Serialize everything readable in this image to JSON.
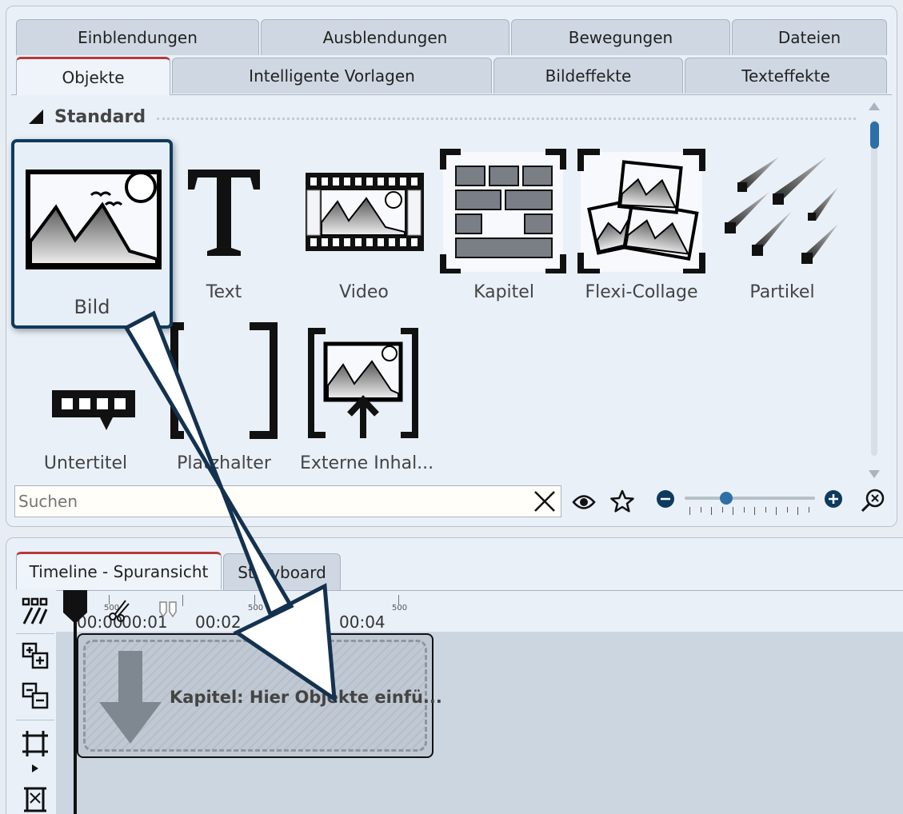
{
  "tabs_row1": [
    "Einblendungen",
    "Ausblendungen",
    "Bewegungen",
    "Dateien"
  ],
  "tabs_row2": [
    "Objekte",
    "Intelligente Vorlagen",
    "Bildeffekte",
    "Texteffekte"
  ],
  "active_tab": "Objekte",
  "section": {
    "label": "Standard"
  },
  "objects": [
    {
      "label": "Bild",
      "icon": "image-icon",
      "selected": true
    },
    {
      "label": "Text",
      "icon": "text-icon"
    },
    {
      "label": "Video",
      "icon": "video-icon"
    },
    {
      "label": "Kapitel",
      "icon": "chapter-icon"
    },
    {
      "label": "Flexi-Collage",
      "icon": "collage-icon"
    },
    {
      "label": "Partikel",
      "icon": "particle-icon"
    },
    {
      "label": "Untertitel",
      "icon": "subtitle-icon"
    },
    {
      "label": "Platzhalter",
      "icon": "placeholder-icon"
    },
    {
      "label": "Externe Inhal...",
      "icon": "external-content-icon"
    }
  ],
  "search": {
    "placeholder": "Suchen"
  },
  "toolbar_icons": [
    "clear-icon",
    "eye-icon",
    "star-icon",
    "zoom-out-icon",
    "zoom-in-icon",
    "zoom-fit-icon"
  ],
  "zoom_level": 0.32,
  "bottom_tabs": [
    "Timeline - Spuransicht",
    "Storyboard"
  ],
  "active_bottom_tab": "Timeline - Spuransicht",
  "ruler": {
    "major": [
      "00:00",
      "00:01",
      "00:02",
      "00:03",
      "00:04"
    ],
    "minor": "500"
  },
  "timeline_tools": [
    "split-tool-icon",
    "add-track-icon",
    "remove-track-icon",
    "crop-frame-icon",
    "fit-frame-icon"
  ],
  "chapter_clip": {
    "label": "Kapitel: Hier Objekte einfü..."
  },
  "colors": {
    "accent_tab": "#b53a3a",
    "selection": "#0e3a5e",
    "slider": "#2f6fa8"
  }
}
